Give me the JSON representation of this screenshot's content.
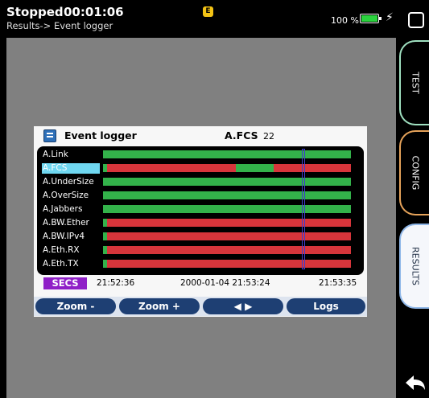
{
  "status": {
    "state": "Stopped",
    "elapsed": "00:01:06",
    "breadcrumb": "Results-> Event logger",
    "badge": "E",
    "battery": "100 %",
    "battery_level": 1.0
  },
  "tabs": {
    "test": "TEST",
    "config": "CONFIG",
    "results": "RESULTS"
  },
  "panel": {
    "title": "Event logger",
    "field": "A.FCS",
    "count": "22"
  },
  "rows": [
    {
      "label": "A.Link"
    },
    {
      "label": "A.FCS"
    },
    {
      "label": "A.UnderSize"
    },
    {
      "label": "A.OverSize"
    },
    {
      "label": "A.Jabbers"
    },
    {
      "label": "A.BW.Ether"
    },
    {
      "label": "A.BW.IPv4"
    },
    {
      "label": "A.Eth.RX"
    },
    {
      "label": "A.Eth.TX"
    }
  ],
  "timeline": {
    "unit": "SECS",
    "start": "21:52:36",
    "cursor": "2000-01-04 21:53:24",
    "end": "21:53:35"
  },
  "buttons": {
    "zoom_out": "Zoom -",
    "zoom_in": "Zoom +",
    "scroll": "◀ ▶",
    "logs": "Logs"
  },
  "colors": {
    "ok": "#33b24a",
    "error": "#d7353b"
  }
}
